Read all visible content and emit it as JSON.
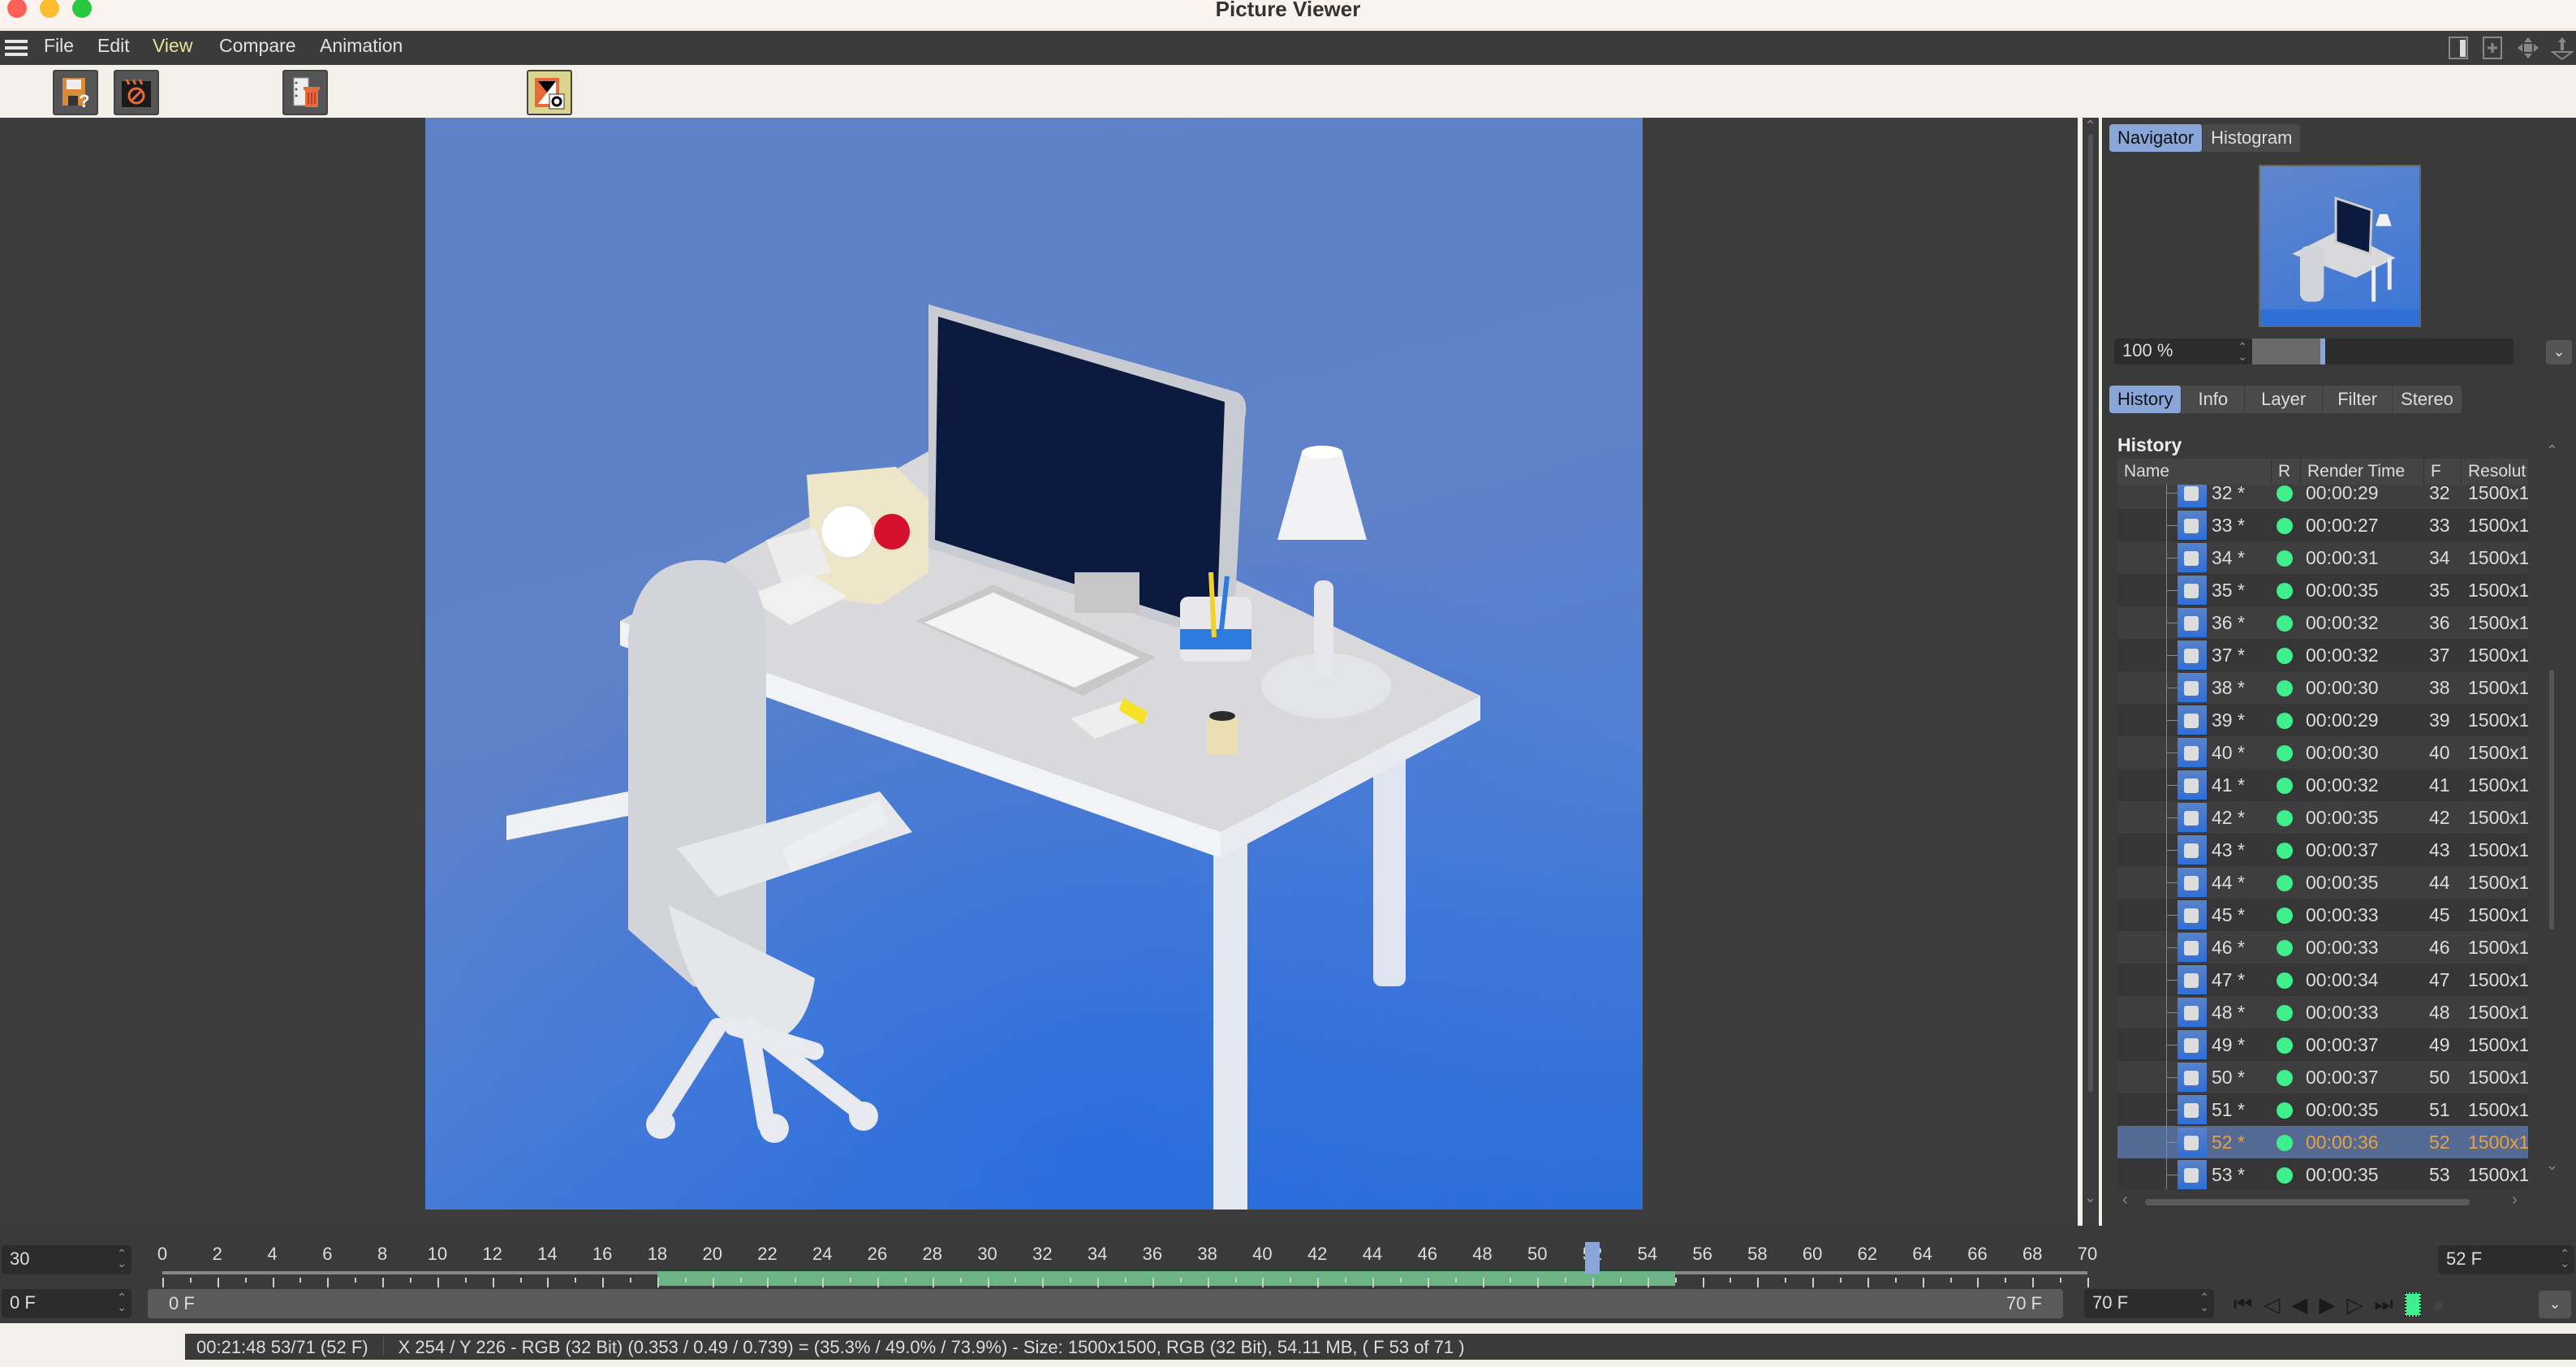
{
  "window": {
    "title": "Picture Viewer"
  },
  "menu": {
    "items": [
      {
        "label": "File"
      },
      {
        "label": "Edit"
      },
      {
        "label": "View",
        "active": true
      },
      {
        "label": "Compare"
      },
      {
        "label": "Animation"
      }
    ],
    "right_icons": [
      "panel-layout-icon",
      "new-panel-icon",
      "move-icon",
      "dock-icon"
    ]
  },
  "toolbar": {
    "buttons": [
      {
        "name": "save-as-icon",
        "tooltip": ""
      },
      {
        "name": "stop-render-icon"
      },
      {
        "name": "delete-frames-icon"
      },
      {
        "name": "ab-compare-icon",
        "highlighted": true
      }
    ]
  },
  "navigator": {
    "tabs": [
      {
        "label": "Navigator",
        "active": true
      },
      {
        "label": "Histogram"
      }
    ],
    "zoom_value": "100 %",
    "zoom_fraction": 0.27
  },
  "history_panel": {
    "tabs": [
      {
        "label": "History",
        "active": true
      },
      {
        "label": "Info"
      },
      {
        "label": "Layer"
      },
      {
        "label": "Filter"
      },
      {
        "label": "Stereo"
      }
    ],
    "title": "History",
    "columns": [
      "Name",
      "R",
      "Render Time",
      "F",
      "Resolut"
    ],
    "rows": [
      {
        "name": "32 *",
        "time": "00:00:29",
        "f": "32",
        "res": "1500x1"
      },
      {
        "name": "33 *",
        "time": "00:00:27",
        "f": "33",
        "res": "1500x1"
      },
      {
        "name": "34 *",
        "time": "00:00:31",
        "f": "34",
        "res": "1500x1"
      },
      {
        "name": "35 *",
        "time": "00:00:35",
        "f": "35",
        "res": "1500x1"
      },
      {
        "name": "36 *",
        "time": "00:00:32",
        "f": "36",
        "res": "1500x1"
      },
      {
        "name": "37 *",
        "time": "00:00:32",
        "f": "37",
        "res": "1500x1"
      },
      {
        "name": "38 *",
        "time": "00:00:30",
        "f": "38",
        "res": "1500x1"
      },
      {
        "name": "39 *",
        "time": "00:00:29",
        "f": "39",
        "res": "1500x1"
      },
      {
        "name": "40 *",
        "time": "00:00:30",
        "f": "40",
        "res": "1500x1"
      },
      {
        "name": "41 *",
        "time": "00:00:32",
        "f": "41",
        "res": "1500x1"
      },
      {
        "name": "42 *",
        "time": "00:00:35",
        "f": "42",
        "res": "1500x1"
      },
      {
        "name": "43 *",
        "time": "00:00:37",
        "f": "43",
        "res": "1500x1"
      },
      {
        "name": "44 *",
        "time": "00:00:35",
        "f": "44",
        "res": "1500x1"
      },
      {
        "name": "45 *",
        "time": "00:00:33",
        "f": "45",
        "res": "1500x1"
      },
      {
        "name": "46 *",
        "time": "00:00:33",
        "f": "46",
        "res": "1500x1"
      },
      {
        "name": "47 *",
        "time": "00:00:34",
        "f": "47",
        "res": "1500x1"
      },
      {
        "name": "48 *",
        "time": "00:00:33",
        "f": "48",
        "res": "1500x1"
      },
      {
        "name": "49 *",
        "time": "00:00:37",
        "f": "49",
        "res": "1500x1"
      },
      {
        "name": "50 *",
        "time": "00:00:37",
        "f": "50",
        "res": "1500x1"
      },
      {
        "name": "51 *",
        "time": "00:00:35",
        "f": "51",
        "res": "1500x1"
      },
      {
        "name": "52 *",
        "time": "00:00:36",
        "f": "52",
        "res": "1500x1",
        "selected": true
      },
      {
        "name": "53 *",
        "time": "00:00:35",
        "f": "53",
        "res": "1500x1"
      }
    ],
    "status_color": "#3ef08d",
    "selected_text_color": "#e9a23b"
  },
  "timeline": {
    "fps": "30",
    "start": "0 F",
    "range_start_label": "0 F",
    "range_end_label": "70 F",
    "end": "70 F",
    "current": "52 F",
    "tick_labels": [
      "0",
      "2",
      "4",
      "6",
      "8",
      "10",
      "12",
      "14",
      "16",
      "18",
      "20",
      "22",
      "24",
      "26",
      "28",
      "30",
      "32",
      "34",
      "36",
      "38",
      "40",
      "42",
      "44",
      "46",
      "48",
      "50",
      "52",
      "54",
      "56",
      "58",
      "60",
      "62",
      "64",
      "66",
      "68",
      "70"
    ],
    "min_frame": 0,
    "max_frame": 70,
    "rendered_range": [
      18,
      55
    ],
    "playhead_frame": 52,
    "transport": [
      "first-frame-icon",
      "prev-key-icon",
      "play-backward-icon",
      "play-forward-icon",
      "next-key-icon",
      "last-frame-icon",
      "film-icon",
      "record-icon"
    ]
  },
  "statusbar": {
    "time_info": "00:21:48 53/71 (52 F)",
    "pixel_info": "X 254 / Y 226 - RGB (32 Bit) (0.353 / 0.49 / 0.739) = (35.3% / 49.0% / 73.9%) - Size: 1500x1500, RGB (32 Bit), 54.11 MB,  ( F 53 of 71 )"
  }
}
